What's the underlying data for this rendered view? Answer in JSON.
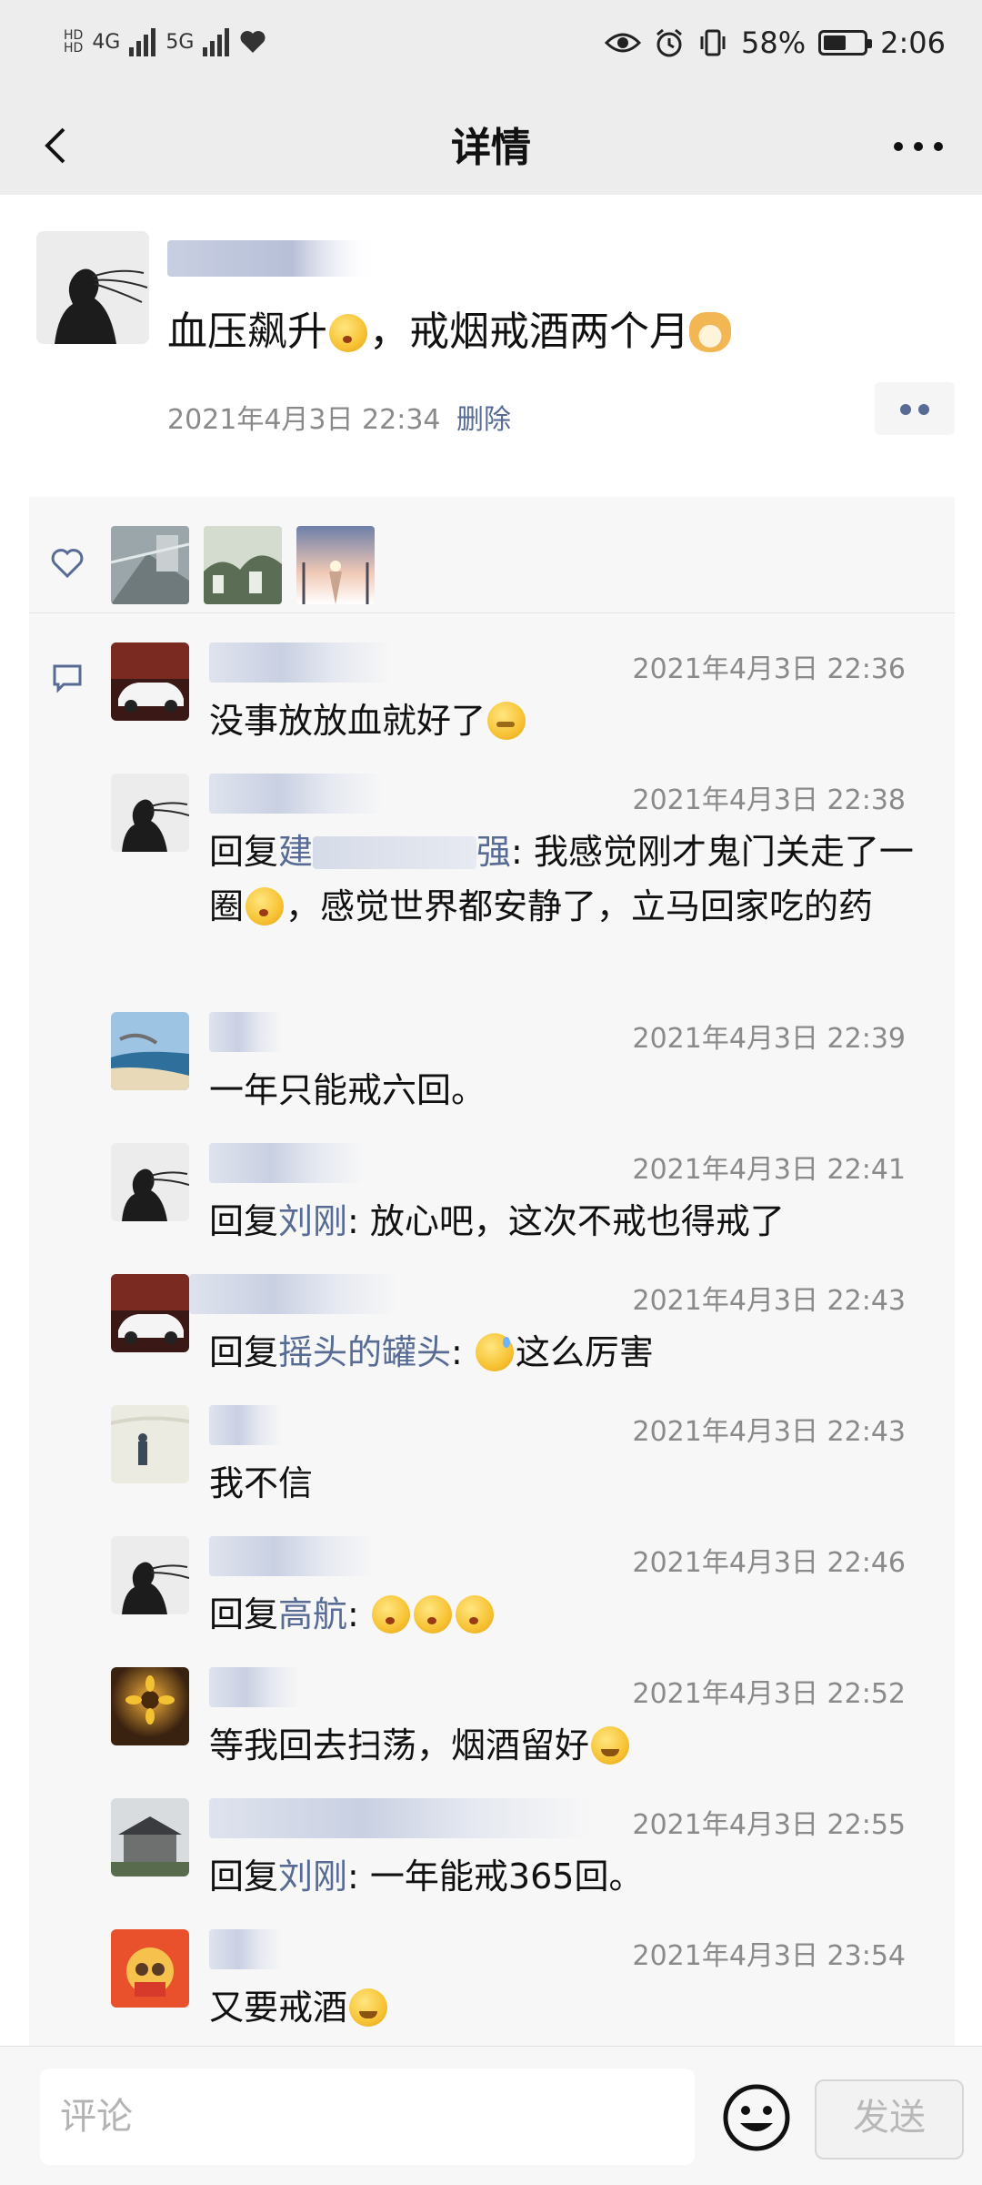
{
  "status_bar": {
    "network": "4G",
    "network2": "5G",
    "battery": "58%",
    "battery_level": 0.58,
    "time": "2:06"
  },
  "navbar": {
    "title": "详情",
    "back_icon": "chevron-left-icon",
    "more_icon": "more-dots-icon"
  },
  "post": {
    "text": "血压飙升",
    "text2": "，戒烟戒酒两个月",
    "time": "2021年4月3日 22:34",
    "delete_label": "删除"
  },
  "comments": [
    {
      "time": "2021年4月3日 22:36",
      "text": "没事放放血就好了"
    },
    {
      "time": "2021年4月3日 22:38",
      "reply_prefix": "回复",
      "reply_to": "建",
      "reply_to_tail": "强",
      "text": ": 我感觉刚才鬼门关走了一圈",
      "text2": "，感觉世界都安静了，立马回家吃的药"
    },
    {
      "time": "2021年4月3日 22:39",
      "text": "一年只能戒六回。"
    },
    {
      "time": "2021年4月3日 22:41",
      "reply_prefix": "回复",
      "reply_to": "刘刚",
      "text": ": 放心吧，这次不戒也得戒了"
    },
    {
      "time": "2021年4月3日 22:43",
      "reply_prefix": "回复",
      "reply_to": "摇头的罐头",
      "text": ": ",
      "text2": "这么厉害"
    },
    {
      "time": "2021年4月3日 22:43",
      "text": "我不信"
    },
    {
      "time": "2021年4月3日 22:46",
      "reply_prefix": "回复",
      "reply_to": "高航",
      "text": ": "
    },
    {
      "time": "2021年4月3日 22:52",
      "text": "等我回去扫荡，烟酒留好"
    },
    {
      "time": "2021年4月3日 22:55",
      "reply_prefix": "回复",
      "reply_to": "刘刚",
      "text": ": 一年能戒365回。"
    },
    {
      "time": "2021年4月3日 23:54",
      "text": "又要戒酒"
    }
  ],
  "bottom": {
    "input_placeholder": "评论",
    "send_label": "发送"
  },
  "colors": {
    "link": "#576b95",
    "nav_bg": "#ededed",
    "panel_bg": "#f7f7f7"
  }
}
